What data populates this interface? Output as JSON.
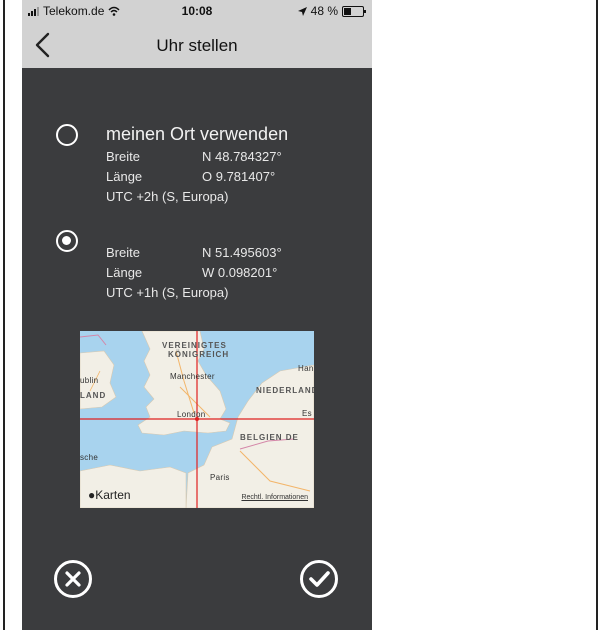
{
  "status_bar": {
    "carrier": "Telekom.de",
    "time": "10:08",
    "battery": "48 %"
  },
  "nav": {
    "title": "Uhr stellen"
  },
  "option_own_location": {
    "title": "meinen Ort verwenden",
    "selected": false,
    "latitude_label": "Breite",
    "latitude_value": "N 48.784327°",
    "longitude_label": "Länge",
    "longitude_value": "O 9.781407°",
    "timezone": "UTC +2h  (S, Europa)"
  },
  "option_custom_location": {
    "selected": true,
    "latitude_label": "Breite",
    "latitude_value": "N 51.495603°",
    "longitude_label": "Länge",
    "longitude_value": "W 0.098201°",
    "timezone": "UTC +1h  (S, Europa)"
  },
  "map": {
    "labels": {
      "uk_line1": "VEREINIGTES",
      "uk_line2": "KÖNIGREICH",
      "manchester": "Manchester",
      "dublin": "ublin",
      "land": "LAND",
      "london": "London",
      "niederland": "NIEDERLAND",
      "belgien": "BELGIEN  DE",
      "paris": "Paris",
      "han": "Han",
      "es": "Es",
      "sche": "sche"
    },
    "brand": "Karten",
    "legal": "Rechtl. Informationen"
  },
  "colors": {
    "background": "#3b3c3e",
    "topbar": "#d2d2d2",
    "water": "#a8d3ee",
    "land": "#f2efe6",
    "crosshair": "#e02020"
  }
}
